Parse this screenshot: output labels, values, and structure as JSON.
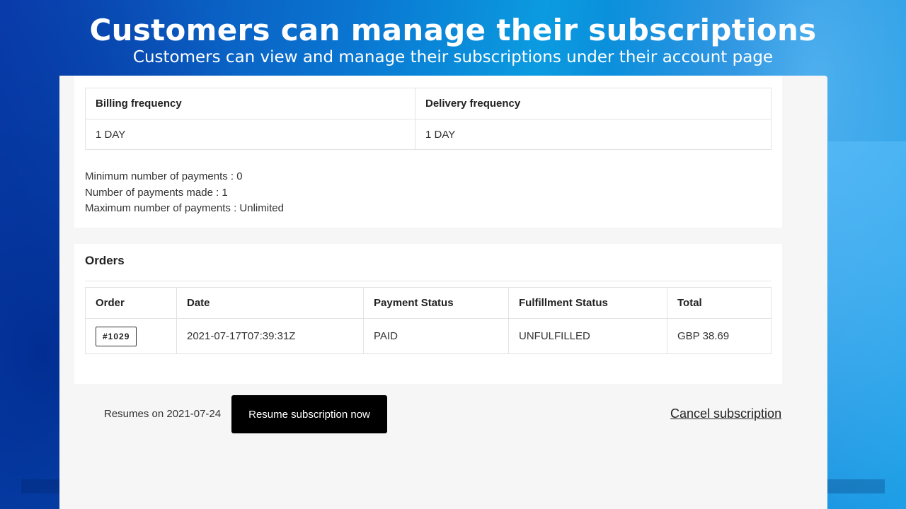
{
  "hero": {
    "title": "Customers can manage their subscriptions",
    "subtitle": "Customers can view and manage their subscriptions under their account page"
  },
  "frequency": {
    "headers": [
      "Billing frequency",
      "Delivery frequency"
    ],
    "values": [
      "1 DAY",
      "1 DAY"
    ]
  },
  "payments": {
    "min": "Minimum number of payments : 0",
    "made": "Number of payments made : 1",
    "max": "Maximum number of payments : Unlimited"
  },
  "orders": {
    "title": "Orders",
    "headers": [
      "Order",
      "Date",
      "Payment Status",
      "Fulfillment Status",
      "Total"
    ],
    "rows": [
      {
        "order": "#1029",
        "date": "2021-07-17T07:39:31Z",
        "payment": "PAID",
        "fulfillment": "UNFULFILLED",
        "total": "GBP 38.69"
      }
    ]
  },
  "actions": {
    "resumes_text": "Resumes on 2021-07-24",
    "resume_label": "Resume subscription now",
    "cancel_label": "Cancel subscription"
  },
  "colors": {
    "background_blue": "#0a74d0",
    "button_black": "#000000",
    "panel_gray": "#f6f6f6"
  }
}
